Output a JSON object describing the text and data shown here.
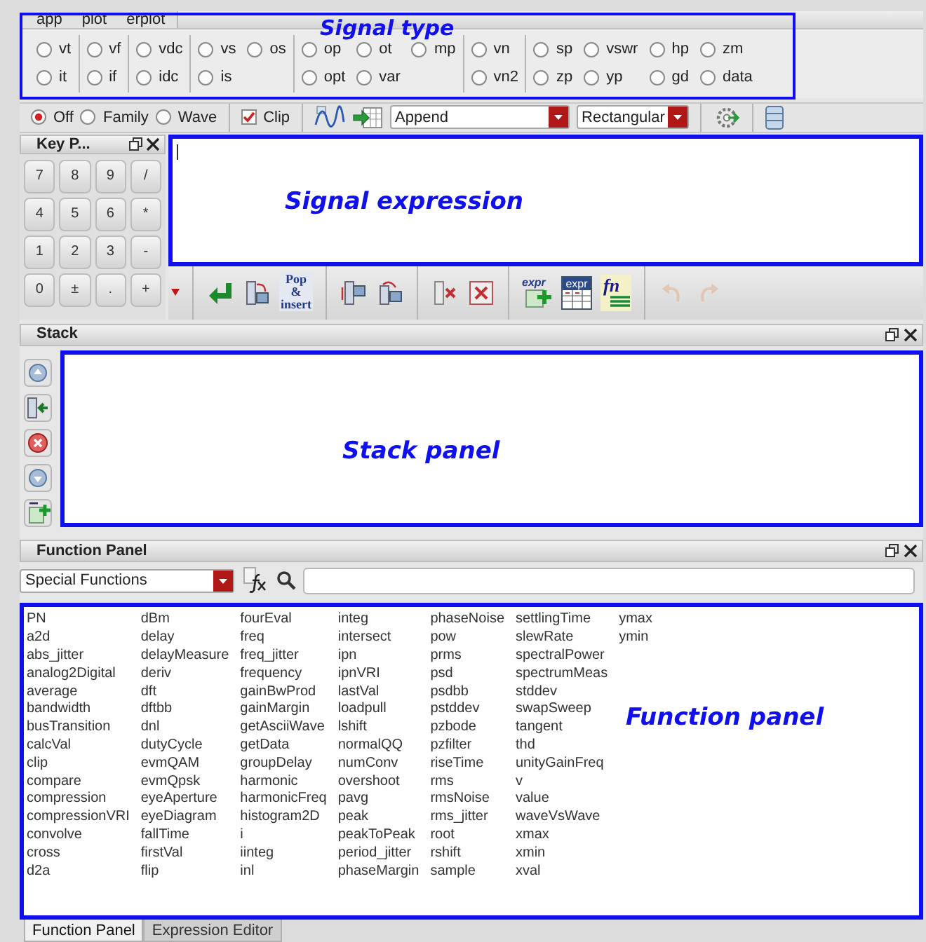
{
  "menu": [
    "app",
    "plot",
    "erplot"
  ],
  "signal_types": [
    {
      "rows": [
        [
          {
            "label": "vt",
            "selected": false
          }
        ],
        [
          {
            "label": "it",
            "selected": false
          }
        ]
      ]
    },
    {
      "rows": [
        [
          {
            "label": "vf",
            "selected": false
          }
        ],
        [
          {
            "label": "if",
            "selected": false
          }
        ]
      ]
    },
    {
      "rows": [
        [
          {
            "label": "vdc",
            "selected": false
          }
        ],
        [
          {
            "label": "idc",
            "selected": false
          }
        ]
      ]
    },
    {
      "rows": [
        [
          {
            "label": "vs",
            "selected": false
          },
          {
            "label": "os",
            "selected": false
          }
        ],
        [
          {
            "label": "is",
            "selected": false
          }
        ]
      ]
    },
    {
      "rows": [
        [
          {
            "label": "op",
            "selected": false
          },
          {
            "label": "ot",
            "selected": false
          },
          {
            "label": "mp",
            "selected": false
          }
        ],
        [
          {
            "label": "opt",
            "selected": false
          },
          {
            "label": "var",
            "selected": false
          }
        ]
      ]
    },
    {
      "rows": [
        [
          {
            "label": "vn",
            "selected": false
          }
        ],
        [
          {
            "label": "vn2",
            "selected": false
          }
        ]
      ]
    },
    {
      "rows": [
        [
          {
            "label": "sp",
            "selected": false
          },
          {
            "label": "vswr",
            "selected": false
          },
          {
            "label": "hp",
            "selected": false
          },
          {
            "label": "zm",
            "selected": false
          }
        ],
        [
          {
            "label": "zp",
            "selected": false
          },
          {
            "label": "yp",
            "selected": false
          },
          {
            "label": "gd",
            "selected": false
          },
          {
            "label": "data",
            "selected": false
          }
        ]
      ]
    }
  ],
  "plot_modes": [
    {
      "label": "Off",
      "selected": true
    },
    {
      "label": "Family",
      "selected": false
    },
    {
      "label": "Wave",
      "selected": false
    }
  ],
  "clip": {
    "label": "Clip",
    "checked": true
  },
  "append_dropdown": {
    "value": "Append"
  },
  "format_dropdown": {
    "value": "Rectangular"
  },
  "keypad": {
    "title": "Key P...",
    "keys": [
      "7",
      "8",
      "9",
      "/",
      "4",
      "5",
      "6",
      "*",
      "1",
      "2",
      "3",
      "-",
      "0",
      "±",
      ".",
      "+"
    ]
  },
  "expression_toolbar": [
    {
      "kind": "return"
    },
    {
      "kind": "push"
    },
    {
      "kind": "text",
      "text": "Pop & insert"
    },
    {
      "kind": "sep"
    },
    {
      "kind": "swap"
    },
    {
      "kind": "rotate"
    },
    {
      "kind": "sep"
    },
    {
      "kind": "clear"
    },
    {
      "kind": "clear-all"
    },
    {
      "kind": "sep"
    },
    {
      "kind": "expr-add",
      "text": "expr"
    },
    {
      "kind": "expr-table",
      "text": "expr"
    },
    {
      "kind": "fn",
      "text": "fn"
    },
    {
      "kind": "sep"
    },
    {
      "kind": "undo",
      "disabled": true
    },
    {
      "kind": "redo",
      "disabled": true
    }
  ],
  "stack": {
    "title": "Stack",
    "buttons": [
      {
        "kind": "up"
      },
      {
        "kind": "push"
      },
      {
        "kind": "delete"
      },
      {
        "kind": "down"
      },
      {
        "kind": "expr-add"
      }
    ]
  },
  "function_panel": {
    "title": "Function Panel",
    "category": "Special Functions",
    "columns": [
      [
        "PN",
        "a2d",
        "abs_jitter",
        "analog2Digital",
        "average",
        "bandwidth",
        "busTransition",
        "calcVal",
        "clip",
        "compare",
        "compression",
        "compressionVRI",
        "convolve",
        "cross",
        "d2a"
      ],
      [
        "dBm",
        "delay",
        "delayMeasure",
        "deriv",
        "dft",
        "dftbb",
        "dnl",
        "dutyCycle",
        "evmQAM",
        "evmQpsk",
        "eyeAperture",
        "eyeDiagram",
        "fallTime",
        "firstVal",
        "flip"
      ],
      [
        "fourEval",
        "freq",
        "freq_jitter",
        "frequency",
        "gainBwProd",
        "gainMargin",
        "getAsciiWave",
        "getData",
        "groupDelay",
        "harmonic",
        "harmonicFreq",
        "histogram2D",
        "i",
        "iinteg",
        "inl"
      ],
      [
        "integ",
        "intersect",
        "ipn",
        "ipnVRI",
        "lastVal",
        "loadpull",
        "lshift",
        "normalQQ",
        "numConv",
        "overshoot",
        "pavg",
        "peak",
        "peakToPeak",
        "period_jitter",
        "phaseMargin"
      ],
      [
        "phaseNoise",
        "pow",
        "prms",
        "psd",
        "psdbb",
        "pstddev",
        "pzbode",
        "pzfilter",
        "riseTime",
        "rms",
        "rmsNoise",
        "rms_jitter",
        "root",
        "rshift",
        "sample"
      ],
      [
        "settlingTime",
        "slewRate",
        "spectralPower",
        "spectrumMeas",
        "stddev",
        "swapSweep",
        "tangent",
        "thd",
        "unityGainFreq",
        "v",
        "value",
        "waveVsWave",
        "xmax",
        "xmin",
        "xval"
      ],
      [
        "ymax",
        "ymin"
      ]
    ]
  },
  "bottom_tabs": [
    {
      "label": "Function Panel",
      "selected": true
    },
    {
      "label": "Expression Editor",
      "selected": false
    }
  ],
  "annotations": [
    "Signal type",
    "Signal expression",
    "Stack panel",
    "Function panel"
  ]
}
